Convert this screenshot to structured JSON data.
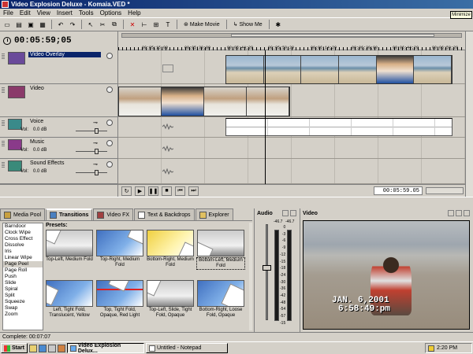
{
  "window": {
    "title": "Video Explosion Deluxe - Komaia.VED *",
    "tooltip": "Minimize"
  },
  "menu": [
    "File",
    "Edit",
    "View",
    "Insert",
    "Tools",
    "Options",
    "Help"
  ],
  "toolbar": {
    "make_movie": "Make Movie",
    "show_me": "Show Me"
  },
  "timeline": {
    "timecode": "00:05:59;05",
    "ruler_labels": [
      "00:05:15;00",
      "00:05:30;00",
      "00:05:44;29",
      "00:05:59;29",
      "00:06:14;29",
      "00:06:30;00",
      "00:06:44;29",
      "00:06:59;29"
    ],
    "tracks": {
      "video_overlay": "Video Overlay",
      "video": "Video",
      "voice": "Voice",
      "music": "Music",
      "sound_effects": "Sound Effects"
    },
    "vol_label": "Vol:",
    "vol_value": "0.0 dB",
    "position": "00:05:59.05"
  },
  "tabs": [
    "Media Pool",
    "Transitions",
    "Video FX",
    "Text & Backdrops",
    "Explorer"
  ],
  "transitions": {
    "effects": [
      "Barndoor",
      "Clock Wipe",
      "Cross Effect",
      "Dissolve",
      "Iris",
      "Linear Wipe",
      "Page Peel",
      "Page Roll",
      "Push",
      "Slide",
      "Spiral",
      "Split",
      "Squeeze",
      "Swap",
      "Zoom"
    ],
    "selected_effect": "Page Peel",
    "presets_label": "Presets:",
    "presets": [
      "Top-Left, Medium Fold",
      "Top-Right, Medium Fold",
      "Bottom-Right, Medium Fold",
      "Bottom-Left, Medium Fold",
      "Left, Tight Fold, Translucent, Yellow",
      "Top, Tight Fold, Opaque, Red Light",
      "Top-Left, Slide, Tight Fold, Opaque",
      "Bottom-Right, Loose Fold, Opaque"
    ]
  },
  "audio": {
    "title": "Audio",
    "peak_left": "-46.7",
    "peak_right": "-46.7",
    "scale": [
      "0",
      "-3",
      "-6",
      "-9",
      "-12",
      "-15",
      "-18",
      "-24",
      "-30",
      "-36",
      "-42",
      "-48",
      "-54",
      "-57",
      "-15"
    ]
  },
  "video": {
    "title": "Video",
    "date_stamp": "JAN. 6,2001",
    "time_stamp": "6:58:49:pm"
  },
  "status": "Complete: 00:07:07",
  "taskbar": {
    "start": "Start",
    "items": [
      "Video Explosion Delux...",
      "Untitled - Notepad"
    ],
    "clock": "2:20 PM"
  }
}
